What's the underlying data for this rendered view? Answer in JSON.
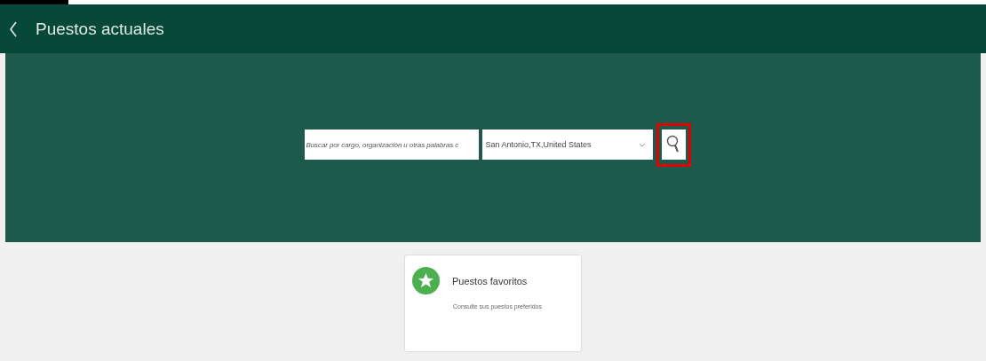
{
  "header": {
    "title": "Puestos actuales"
  },
  "search": {
    "placeholder": "Buscar por cargo, organización u otras palabras c",
    "location": "San Antonio,TX,United States",
    "highlighted": true
  },
  "card": {
    "title": "Puestos favoritos",
    "description": "Consulte sus puestos preferidos"
  }
}
